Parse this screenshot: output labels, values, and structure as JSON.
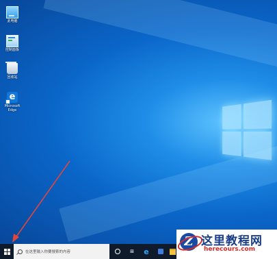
{
  "desktop": {
    "icons": [
      {
        "label": "此电脑",
        "icon": "computer-icon"
      },
      {
        "label": "控制面板",
        "icon": "control-panel-icon"
      },
      {
        "label": "回收站",
        "icon": "recycle-bin-icon"
      },
      {
        "label": "Microsoft\nEdge",
        "icon": "edge-icon"
      }
    ],
    "wallpaper": "Windows 10 default blue",
    "annotation_color": "#e0463e"
  },
  "taskbar": {
    "search_placeholder": "在这里输入你要搜索的内容",
    "task_view_glyph": "⊞",
    "edge_glyph": "e",
    "background": "#0f1b2a"
  },
  "watermark": {
    "title": "这里教程网",
    "url": "herecours.com",
    "logo_letter": "Z"
  }
}
